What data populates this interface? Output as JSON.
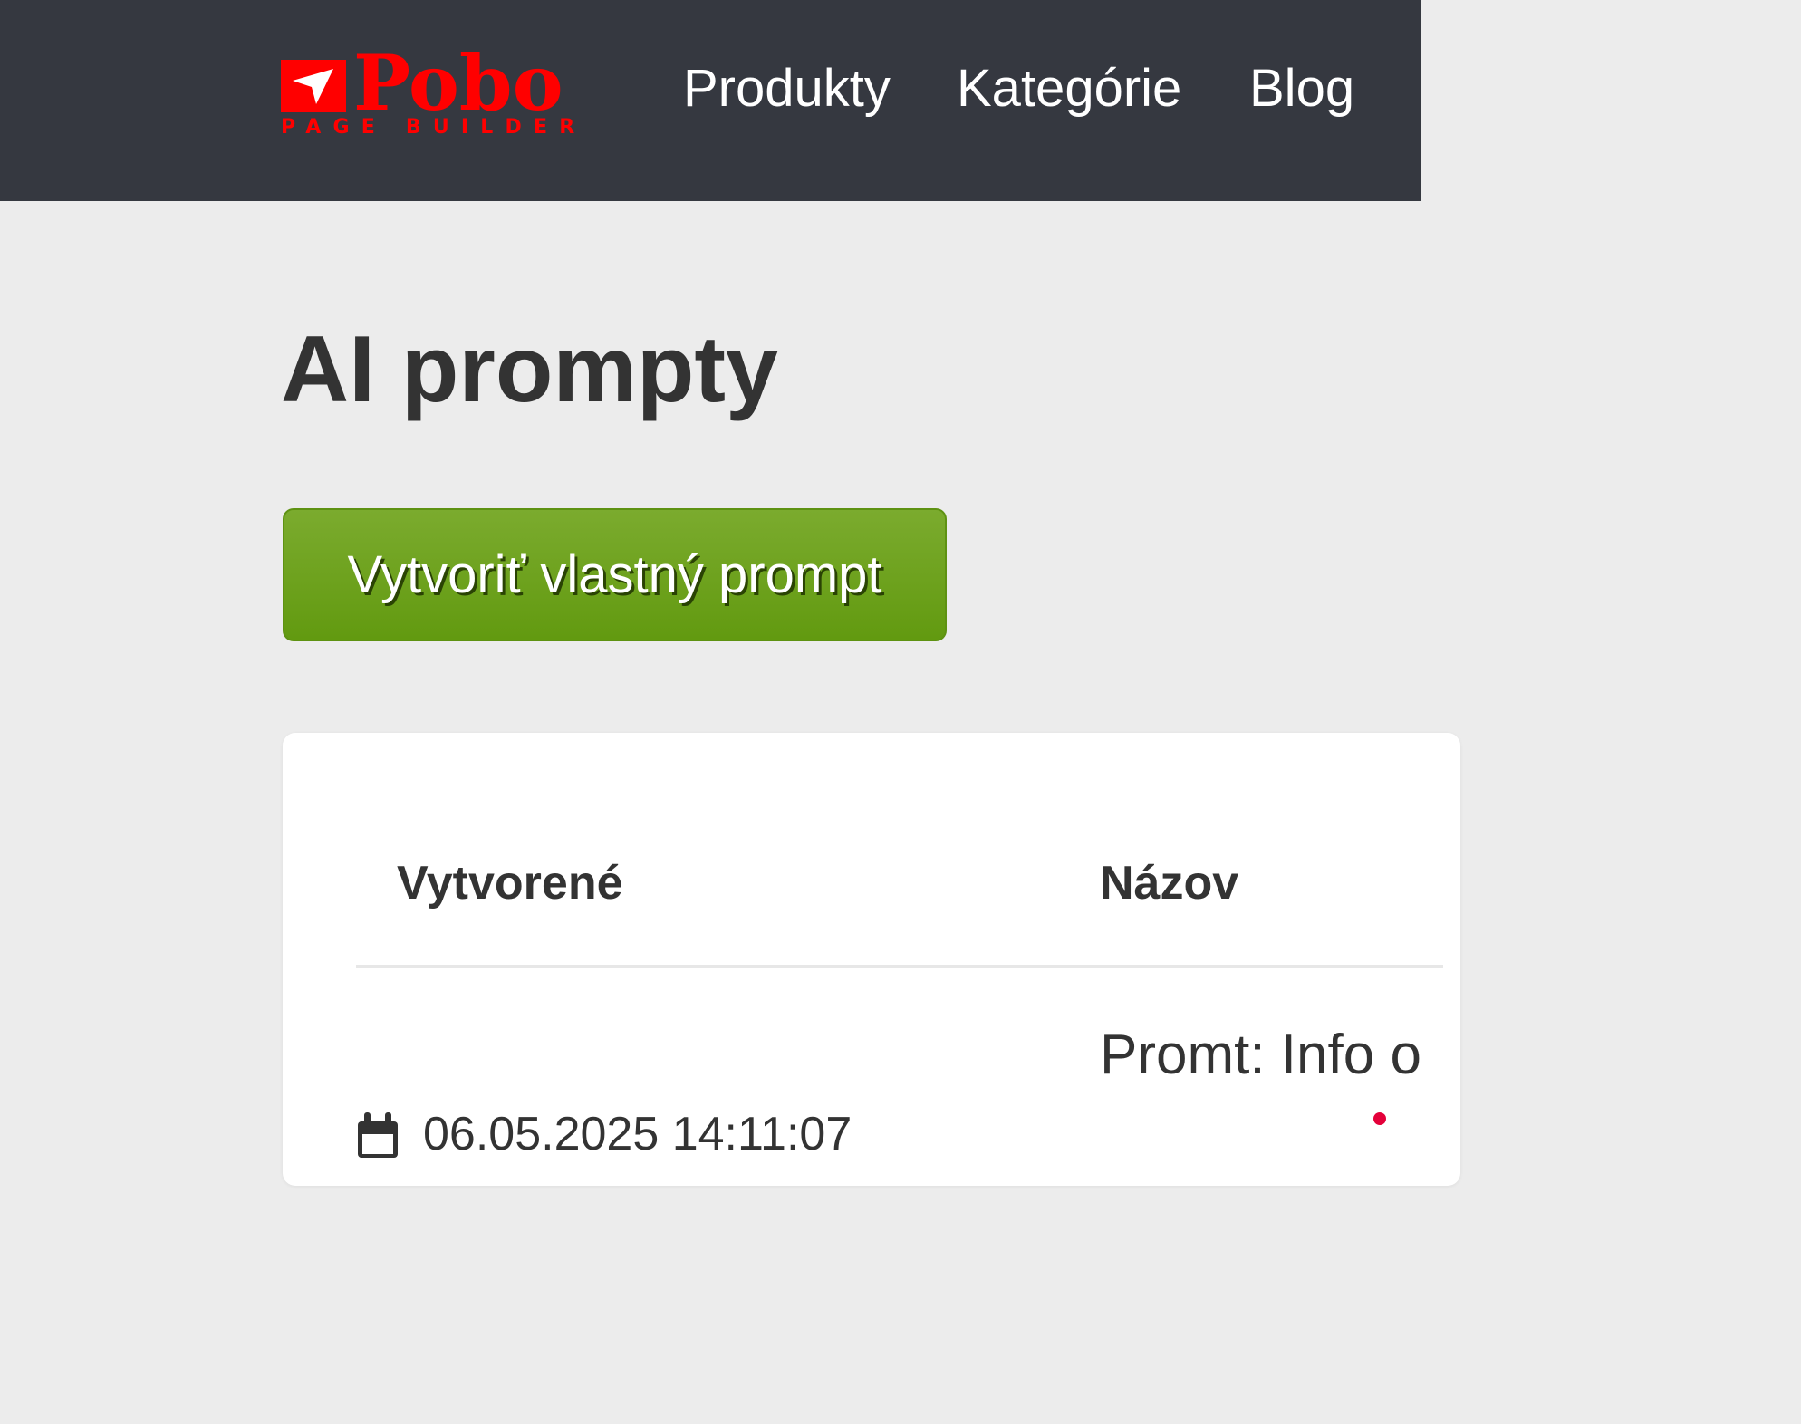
{
  "brand": {
    "logo_name": "Pobo",
    "logo_tagline": "PAGE BUILDER",
    "logo_color": "#ff0000"
  },
  "nav": {
    "items": [
      {
        "label": "Produkty"
      },
      {
        "label": "Kategórie"
      },
      {
        "label": "Blog"
      }
    ]
  },
  "page": {
    "title": "AI prompty",
    "create_button_label": "Vytvoriť vlastný prompt"
  },
  "table": {
    "columns": [
      "Vytvorené",
      "Názov"
    ],
    "rows": [
      {
        "created": "06.05.2025 14:11:07",
        "name": "Promt: Info o"
      }
    ]
  },
  "colors": {
    "topbar": "#353840",
    "background": "#ececec",
    "button": "#6ea21d",
    "text": "#333333"
  },
  "icons": {
    "logo_mark": "paper-plane-arrow",
    "date": "calendar-icon"
  }
}
